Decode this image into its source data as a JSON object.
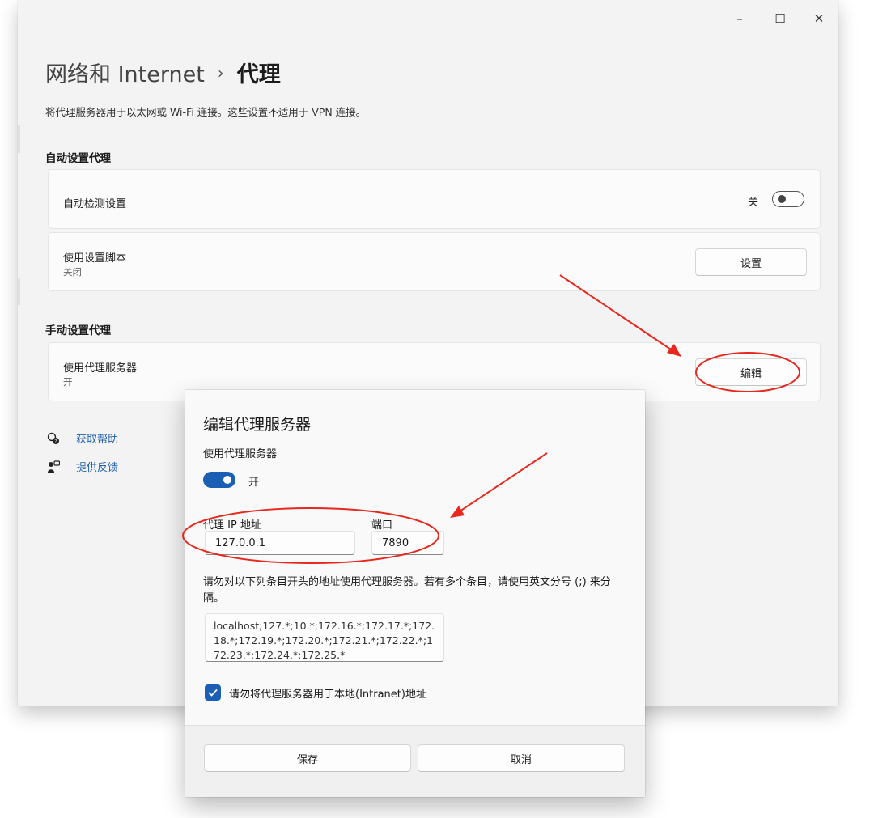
{
  "window": {
    "controls": {
      "minimize": "–",
      "maximize": "☐",
      "close": "✕"
    }
  },
  "breadcrumb": {
    "parent": "网络和 Internet",
    "separator": "›",
    "current": "代理"
  },
  "description": "将代理服务器用于以太网或 Wi-Fi 连接。这些设置不适用于 VPN 连接。",
  "auto_section": {
    "title": "自动设置代理",
    "detect": {
      "label": "自动检测设置",
      "state": "关",
      "on": false
    },
    "script": {
      "label": "使用设置脚本",
      "sub": "关闭",
      "button": "设置"
    }
  },
  "manual_section": {
    "title": "手动设置代理",
    "proxy": {
      "label": "使用代理服务器",
      "sub": "开",
      "button": "编辑"
    }
  },
  "links": [
    {
      "label": "获取帮助",
      "icon": "help-icon"
    },
    {
      "label": "提供反馈",
      "icon": "feedback-icon"
    }
  ],
  "dialog": {
    "title": "编辑代理服务器",
    "use_proxy_label": "使用代理服务器",
    "toggle_state": "开",
    "toggle_on": true,
    "ip_label": "代理 IP 地址",
    "ip_value": "127.0.0.1",
    "port_label": "端口",
    "port_value": "7890",
    "exceptions_note": "请勿对以下列条目开头的地址使用代理服务器。若有多个条目，请使用英文分号 (;) 来分隔。",
    "exceptions_value": "localhost;127.*;10.*;172.16.*;172.17.*;172.18.*;172.19.*;172.20.*;172.21.*;172.22.*;172.23.*;172.24.*;172.25.*",
    "bypass_local_label": "请勿将代理服务器用于本地(Intranet)地址",
    "bypass_local_checked": true,
    "save_button": "保存",
    "cancel_button": "取消"
  },
  "colors": {
    "accent": "#1a5fb4",
    "annotation": "#e8281e",
    "link": "#1f5fae"
  }
}
